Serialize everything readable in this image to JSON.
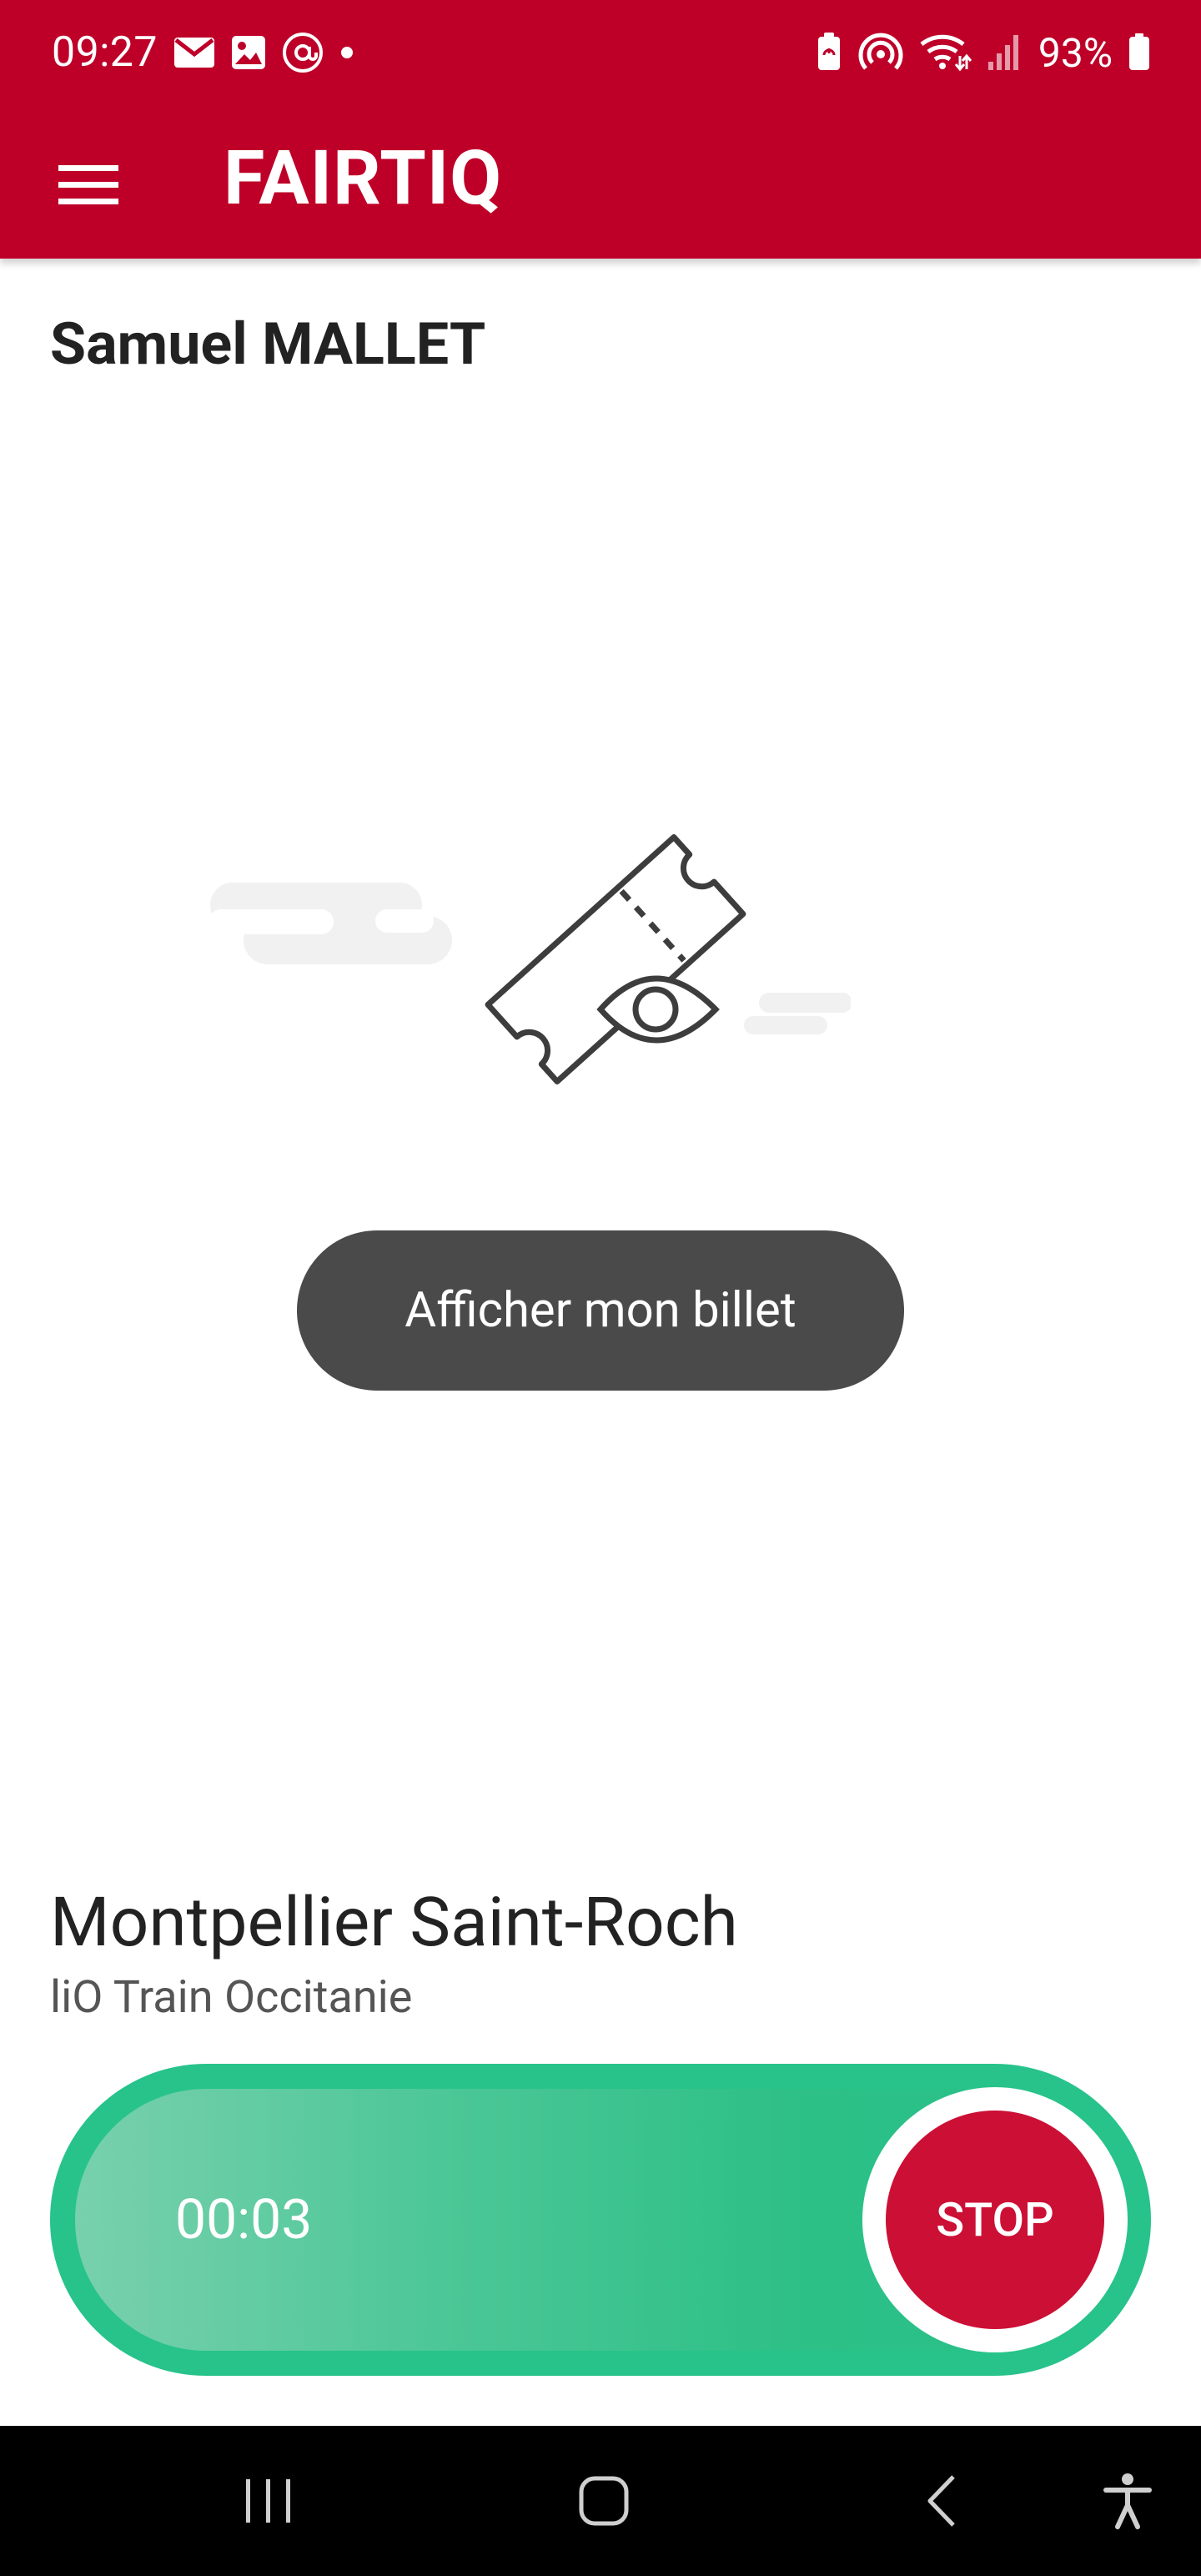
{
  "status_bar": {
    "time": "09:27",
    "battery_percent": "93%",
    "left_icons": [
      "gmail-icon",
      "gallery-icon",
      "at-sign-icon",
      "dot-icon"
    ],
    "right_icons": [
      "battery-saver-icon",
      "hotspot-icon",
      "wifi-icon",
      "signal-icon",
      "battery-icon"
    ]
  },
  "app_bar": {
    "brand": "FAIRTIQ",
    "menu_icon": "hamburger-menu-icon"
  },
  "user": {
    "name": "Samuel MALLET"
  },
  "ticket": {
    "illustration_icon": "ticket-eye-icon",
    "button_label": "Afficher mon billet"
  },
  "journey": {
    "station": "Montpellier Saint-Roch",
    "operator": "liO Train Occitanie",
    "elapsed": "00:03",
    "stop_label": "STOP"
  },
  "colors": {
    "brand_red": "#be0029",
    "button_dark": "#4a4a4a",
    "timer_green": "#27c38a",
    "stop_red": "#cc0f35"
  },
  "nav_bar": {
    "icons": [
      "recent-apps-icon",
      "home-icon",
      "back-icon",
      "accessibility-icon"
    ]
  }
}
